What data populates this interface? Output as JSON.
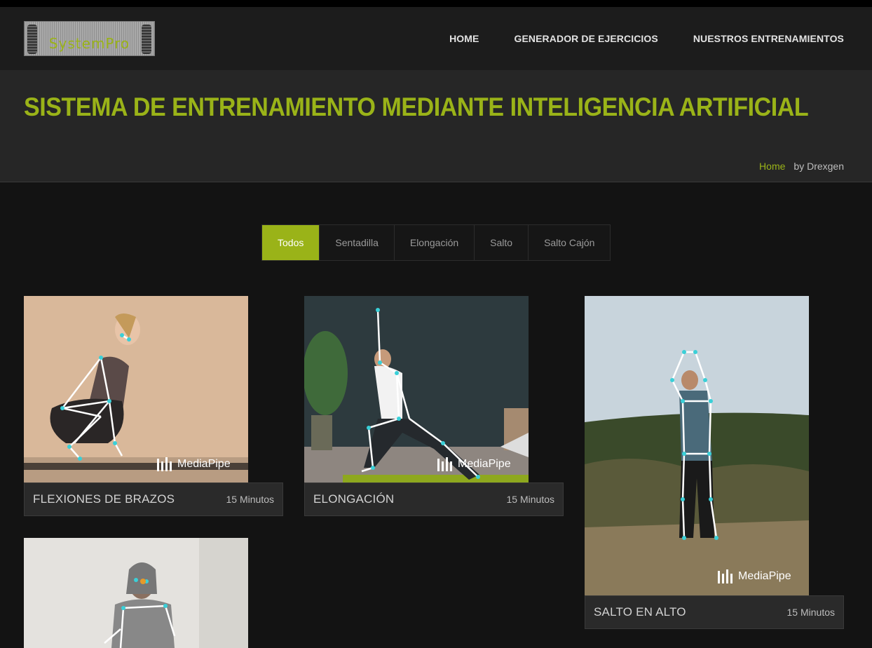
{
  "header": {
    "logo_text": "SystemPro",
    "nav": [
      "HOME",
      "GENERADOR DE EJERCICIOS",
      "NUESTROS ENTRENAMIENTOS"
    ]
  },
  "banner": {
    "title": "SISTEMA DE ENTRENAMIENTO MEDIANTE INTELIGENCIA ARTIFICIAL",
    "breadcrumb_home": "Home",
    "breadcrumb_by": "by Drexgen"
  },
  "filters": [
    "Todos",
    "Sentadilla",
    "Elongación",
    "Salto",
    "Salto Cajón"
  ],
  "active_filter": "Todos",
  "cards": [
    {
      "title": "FLEXIONES DE BRAZOS",
      "duration": "15 Minutos",
      "watermark": "MediaPipe"
    },
    {
      "title": "ELONGACIÓN",
      "duration": "15 Minutos",
      "watermark": "MediaPipe"
    },
    {
      "title": "SALTO EN ALTO",
      "duration": "15 Minutos",
      "watermark": "MediaPipe"
    },
    {
      "title": "",
      "duration": "",
      "watermark": ""
    }
  ],
  "colors": {
    "accent": "#9ab318",
    "background": "#131313",
    "header": "#1c1c1c",
    "banner": "#262626"
  }
}
